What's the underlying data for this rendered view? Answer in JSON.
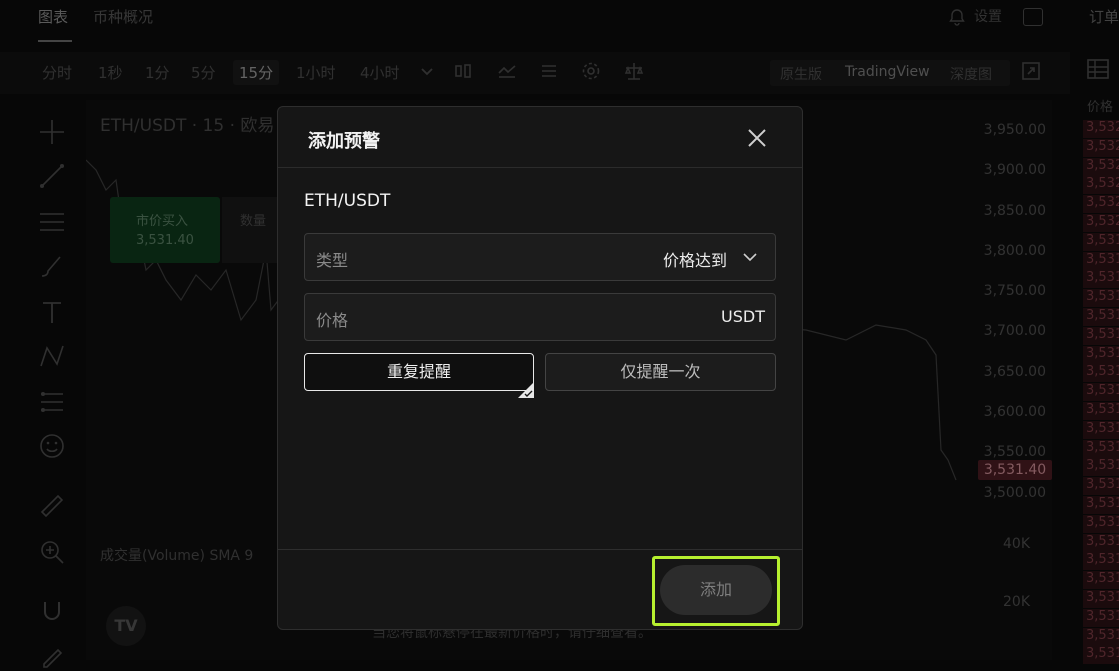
{
  "top_nav": {
    "tabs": [
      "图表",
      "币种概况"
    ],
    "settings_label": "设置"
  },
  "toolbar": {
    "timeframes": [
      "分时",
      "1秒",
      "1分",
      "5分",
      "15分",
      "1小时",
      "4小时"
    ],
    "active_timeframe": "15分",
    "view_modes": [
      "原生版",
      "TradingView",
      "深度图"
    ],
    "active_view": "TradingView"
  },
  "chart": {
    "title": "ETH/USDT · 15 · 欧易",
    "buy_label": "市价买入",
    "buy_price": "3,531.40",
    "qty_label": "数量",
    "volume_label": "成交量(Volume) SMA 9",
    "footer_note": "当您将鼠标悬停在最新价格时，请仔细查看。",
    "current_price": "3,531.40",
    "price_axis": [
      "3,950.00",
      "3,900.00",
      "3,850.00",
      "3,800.00",
      "3,750.00",
      "3,700.00",
      "3,650.00",
      "3,600.00",
      "3,550.00",
      "3,500.00"
    ],
    "volume_axis": [
      "40K",
      "20K"
    ],
    "logo_text": "TV"
  },
  "orderbook": {
    "title": "订单",
    "column_header": "价格",
    "rows": [
      "3,532",
      "3,532",
      "3,532",
      "3,532",
      "3,532",
      "3,532",
      "3,531",
      "3,531",
      "3,531",
      "3,531",
      "3,531",
      "3,531",
      "3,531",
      "3,531",
      "3,531",
      "3,531",
      "3,531",
      "3,531",
      "3,531",
      "3,531",
      "3,531",
      "3,531",
      "3,531",
      "3,531",
      "3,531",
      "3,531",
      "3,531",
      "3,531",
      "3,531"
    ]
  },
  "modal": {
    "title": "添加预警",
    "pair": "ETH/USDT",
    "type_label": "类型",
    "type_value": "价格达到",
    "price_label": "价格",
    "price_unit": "USDT",
    "price_value": "",
    "repeat_option": "重复提醒",
    "once_option": "仅提醒一次",
    "selected_option": "重复提醒",
    "add_button": "添加"
  },
  "colors": {
    "highlight": "#b7f02f",
    "buy": "#0f3a1c",
    "sell": "#4a1d23"
  }
}
